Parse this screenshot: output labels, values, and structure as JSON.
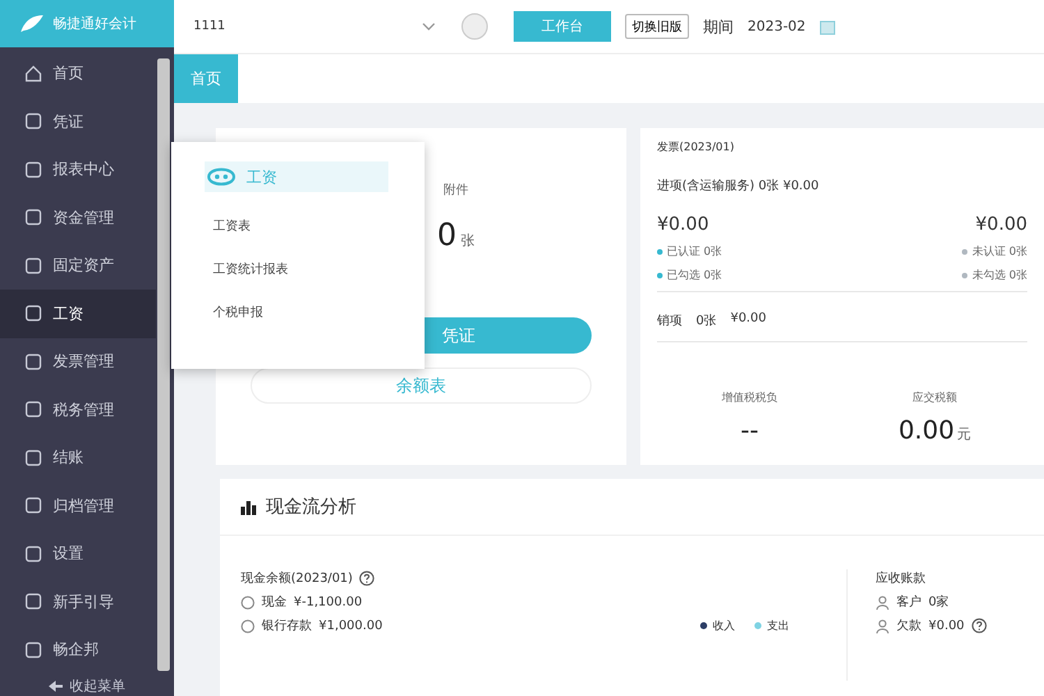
{
  "logo": {
    "title": "畅捷通好会计"
  },
  "sidebar": {
    "items": [
      {
        "label": "首页",
        "selected": false
      },
      {
        "label": "凭证",
        "selected": false
      },
      {
        "label": "报表中心",
        "selected": false
      },
      {
        "label": "资金管理",
        "selected": false
      },
      {
        "label": "固定资产",
        "selected": false
      },
      {
        "label": "工资",
        "selected": true
      },
      {
        "label": "发票管理",
        "selected": false
      },
      {
        "label": "税务管理",
        "selected": false
      },
      {
        "label": "结账",
        "selected": false
      },
      {
        "label": "归档管理",
        "selected": false
      },
      {
        "label": "设置",
        "selected": false
      },
      {
        "label": "新手引导",
        "selected": false
      },
      {
        "label": "畅企邦",
        "selected": false
      }
    ],
    "collapse": "收起菜单"
  },
  "topbar": {
    "account": "1111",
    "workbench": "工作台",
    "switch": "切换旧版",
    "period_label": "期间",
    "period": "2023-02"
  },
  "tabs": [
    {
      "label": "首页",
      "selected": true
    }
  ],
  "popup": {
    "title": "工资",
    "items": [
      "工资表",
      "工资统计报表",
      "个税申报"
    ]
  },
  "voucher_card": {
    "attach_label": "附件",
    "attach_count": "0",
    "attach_unit": "张",
    "primary_button": "凭证",
    "secondary_button": "余额表"
  },
  "invoice_card": {
    "title": "发票(2023/01)",
    "input_line": "进项(含运输服务) 0张  ¥0.00",
    "left_amount": "¥0.00",
    "right_amount": "¥0.00",
    "stats": [
      {
        "label": "已认证",
        "value": "0张",
        "color": "#37b9d0"
      },
      {
        "label": "未认证",
        "value": "0张",
        "color": "#b0b8c0"
      },
      {
        "label": "已勾选",
        "value": "0张",
        "color": "#37b9d0"
      },
      {
        "label": "未勾选",
        "value": "0张",
        "color": "#b0b8c0"
      }
    ],
    "output_label": "销项",
    "output_count": "0张",
    "output_amount": "¥0.00",
    "tax_burden_label": "增值税税负",
    "tax_burden": "--",
    "tax_due_label": "应交税额",
    "tax_due": "0.00",
    "tax_due_unit": "元"
  },
  "cashflow": {
    "title": "现金流分析",
    "balance_title": "现金余额(2023/01)",
    "cash_label": "现金",
    "cash": "¥-1,100.00",
    "bank_label": "银行存款",
    "bank": "¥1,000.00",
    "legend": [
      {
        "label": "收入",
        "color": "#2c3e66"
      },
      {
        "label": "支出",
        "color": "#7fd3e3"
      }
    ],
    "receivable_title": "应收账款",
    "customers_label": "客户",
    "customers": "0家",
    "debt_label": "欠款",
    "debt": "¥0.00"
  }
}
